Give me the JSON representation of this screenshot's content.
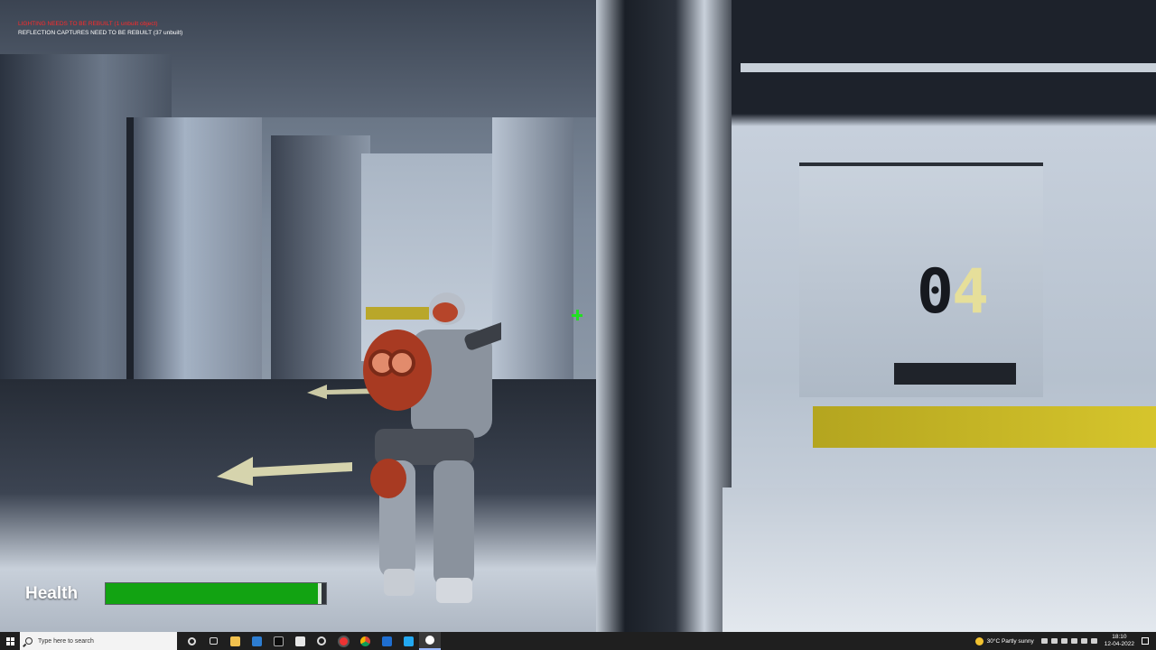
{
  "debug": {
    "error_line": "LIGHTING NEEDS TO BE REBUILT (1 unbuilt object)",
    "warning_line": "REFLECTION CAPTURES NEED TO BE REBUILT (37 unbuilt)"
  },
  "scene": {
    "room_number_dark": "0",
    "room_number_light": "4"
  },
  "hud": {
    "health_label": "Health",
    "health_value": 0.98,
    "health_color": "#12a312"
  },
  "taskbar": {
    "search_placeholder": "Type here to search",
    "pinned_icons": [
      "cortana-icon",
      "task-view-icon",
      "file-explorer-icon",
      "mail-icon",
      "terminal-icon",
      "store-icon",
      "settings-icon",
      "record-icon",
      "chrome-icon",
      "photos-icon",
      "vscode-icon",
      "unreal-engine-icon"
    ],
    "weather_text": "30°C  Partly sunny",
    "time": "18:10",
    "date": "12-04-2022"
  }
}
